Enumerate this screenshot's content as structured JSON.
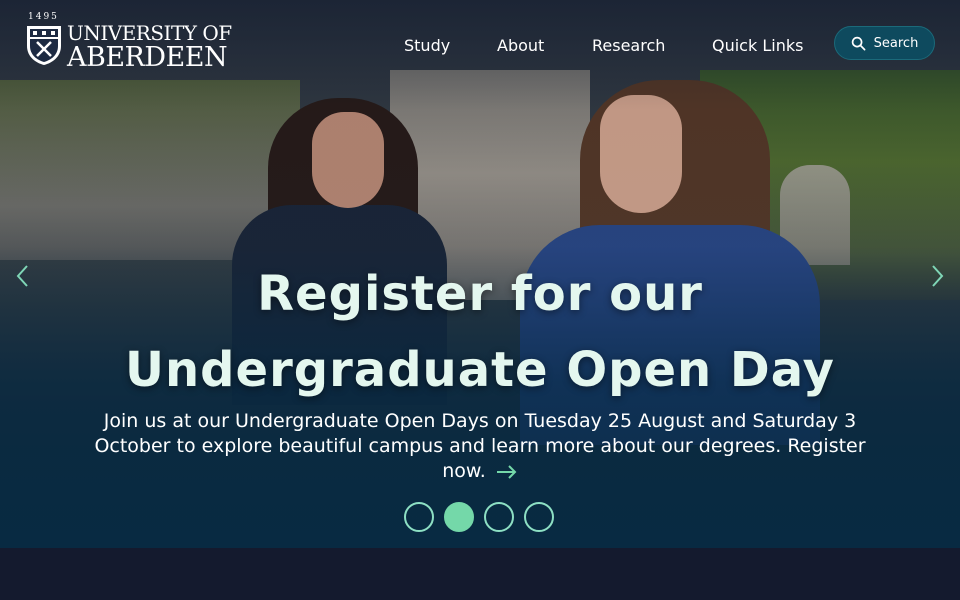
{
  "header": {
    "logo": {
      "year": "1495",
      "line1": "UNIVERSITY OF",
      "line2": "ABERDEEN"
    },
    "nav": [
      {
        "label": "Study"
      },
      {
        "label": "About"
      },
      {
        "label": "Research"
      },
      {
        "label": "Quick Links"
      }
    ],
    "search_label": "Search"
  },
  "hero": {
    "title_line1": "Register for our",
    "title_line2": "Undergraduate Open Day",
    "description": "Join us at our Undergraduate Open Days on Tuesday 25 August and Saturday 3 October to explore beautiful campus and learn more about our degrees. Register now.",
    "active_slide": 2,
    "slide_count": 4
  },
  "colors": {
    "accent": "#74d8a9",
    "headline": "#e4f7ef",
    "search_bg": "#0e4a5e",
    "page_bg": "#141a2e"
  },
  "icons": {
    "search": "search-icon",
    "prev": "chevron-left-icon",
    "next": "chevron-right-icon",
    "cta": "arrow-right-icon"
  }
}
